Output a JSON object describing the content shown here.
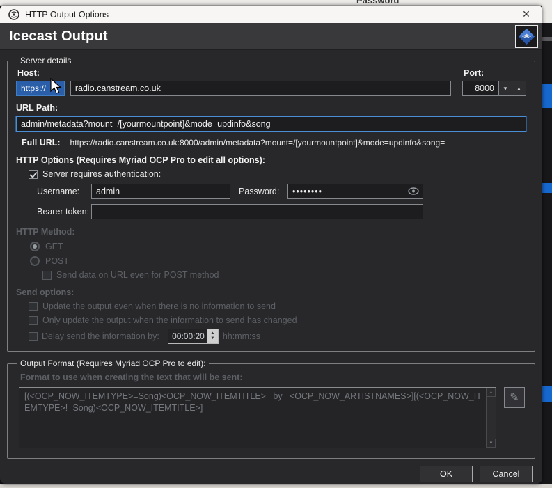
{
  "background": {
    "partial_text": "Password"
  },
  "window": {
    "title": "HTTP Output Options"
  },
  "header": {
    "title": "Icecast Output"
  },
  "icons": {
    "close": "✕",
    "dropdown_arrow": "▼",
    "spin_up": "▲",
    "spin_down": "▼",
    "pencil": "✎"
  },
  "server_details": {
    "legend": "Server details",
    "host": {
      "label": "Host:",
      "protocol": "https://",
      "value": "radio.canstream.co.uk"
    },
    "port": {
      "label": "Port:",
      "value": "8000"
    },
    "url_path": {
      "label": "URL Path:",
      "value": "admin/metadata?mount=/[yourmountpoint]&mode=updinfo&song="
    },
    "full_url": {
      "label": "Full URL:",
      "value": "https://radio.canstream.co.uk:8000/admin/metadata?mount=/[yourmountpoint]&mode=updinfo&song="
    },
    "http_options": {
      "label": "HTTP Options (Requires Myriad OCP Pro to edit all options):",
      "auth_checkbox": "Server requires authentication:",
      "username_label": "Username:",
      "username_value": "admin",
      "password_label": "Password:",
      "password_value": "••••••••",
      "bearer_label": "Bearer token:",
      "bearer_value": ""
    },
    "http_method": {
      "label": "HTTP Method:",
      "get": "GET",
      "post": "POST",
      "post_checkbox": "Send data on URL even for POST method"
    },
    "send_options": {
      "label": "Send options:",
      "opt_update_always": "Update the output even when there is no information to send",
      "opt_update_changed": "Only update the output when the information to send has changed",
      "opt_delay": "Delay send the information by:",
      "delay_value": "00:00:20",
      "delay_unit": "hh:mm:ss"
    }
  },
  "output_format": {
    "legend": "Output Format (Requires Myriad OCP Pro to edit):",
    "format_label": "Format to use when creating the text that will be sent:",
    "format_value": "[(<OCP_NOW_ITEMTYPE>=Song)<OCP_NOW_ITEMTITLE>   by   <OCP_NOW_ARTISTNAMES>][(<OCP_NOW_ITEMTYPE>!=Song)<OCP_NOW_ITEMTITLE>]"
  },
  "footer": {
    "ok": "OK",
    "cancel": "Cancel"
  },
  "colors": {
    "accent_blue": "#2a5ea8",
    "focus_border": "#4a8fd4",
    "strip_blue": "#1668cf"
  }
}
